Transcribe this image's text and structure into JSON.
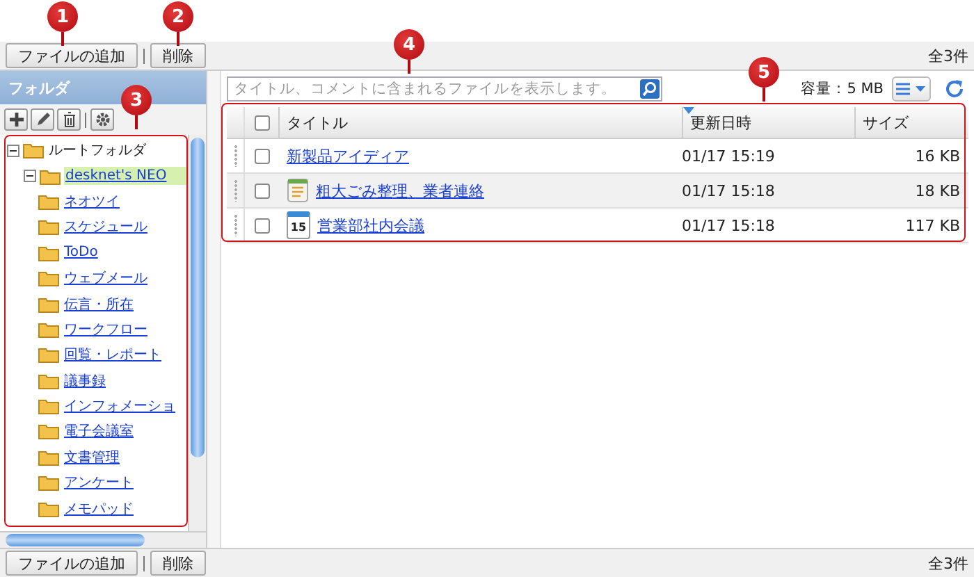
{
  "toolbar": {
    "buttons": [
      "ファイルの追加",
      "削除"
    ],
    "count": "全3件"
  },
  "sidebar": {
    "title": "フォルダ",
    "tree": [
      {
        "label": "ルートフォルダ",
        "expanded": true,
        "selected": false,
        "children": [
          {
            "label": "desknet's NEO",
            "expanded": true,
            "selected": true,
            "children": [
              {
                "label": "ネオツイ"
              },
              {
                "label": "スケジュール"
              },
              {
                "label": "ToDo"
              },
              {
                "label": "ウェブメール"
              },
              {
                "label": "伝言・所在"
              },
              {
                "label": "ワークフロー"
              },
              {
                "label": "回覧・レポート"
              },
              {
                "label": "議事録"
              },
              {
                "label": "インフォメーショ"
              },
              {
                "label": "電子会議室"
              },
              {
                "label": "文書管理"
              },
              {
                "label": "アンケート"
              },
              {
                "label": "メモパッド"
              }
            ]
          }
        ]
      }
    ]
  },
  "search": {
    "placeholder": "タイトル、コメントに含まれるファイルを表示します。"
  },
  "capacity": "容量：5 MB",
  "table": {
    "all_checked": false,
    "columns": [
      {
        "label": "タイトル",
        "sorted": false
      },
      {
        "label": "更新日時",
        "sorted": true
      },
      {
        "label": "サイズ",
        "sorted": false
      }
    ],
    "rows": [
      {
        "kind": "plain",
        "title": "新製品アイディア",
        "date": "01/17 15:19",
        "size": "16 KB",
        "checked": false
      },
      {
        "kind": "memo",
        "title": "粗大ごみ整理、業者連絡",
        "date": "01/17 15:18",
        "size": "18 KB",
        "checked": false
      },
      {
        "kind": "calendar",
        "icon_text": "15",
        "title": "営業部社内会議",
        "date": "01/17 15:18",
        "size": "117 KB",
        "checked": false
      }
    ]
  },
  "bottom_toolbar": {
    "buttons": [
      "ファイルの追加",
      "削除"
    ],
    "count": "全3件"
  },
  "callouts": [
    "1",
    "2",
    "3",
    "4",
    "5"
  ]
}
